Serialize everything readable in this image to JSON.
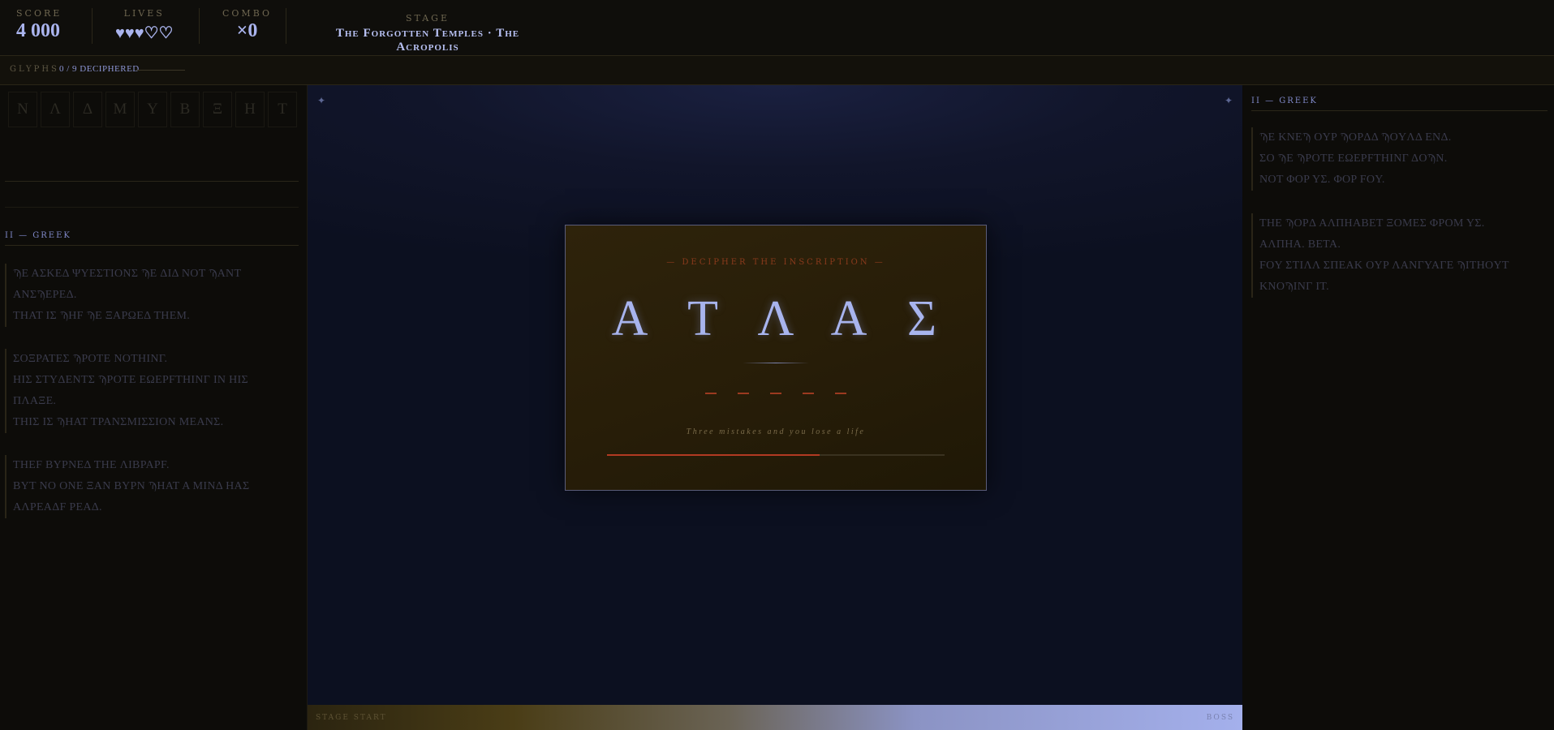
{
  "hud": {
    "score": {
      "label": "SCORE",
      "value": "4 000"
    },
    "lives": {
      "label": "LIVES",
      "value": "♥♥♥♡♡",
      "current": 3,
      "max": 5
    },
    "combo": {
      "label": "COMBO",
      "value": "×0"
    },
    "stage": {
      "label": "STAGE",
      "title": "The Forgotten Temples · The Acropolis"
    }
  },
  "glyphs": {
    "label": "GLYPHS",
    "count": "0 / 9 DECIPHERED",
    "deciphered": 0,
    "total": 9
  },
  "glyph_cells": [
    "N",
    "Λ",
    "Δ",
    "M",
    "Y",
    "B",
    "Ξ",
    "H",
    "T"
  ],
  "left_panel": {
    "heading": "II — GREEK",
    "verses": [
      [
        "ϠE AΣKEΔ ΨYEΣTIONΣ ϠE ΔIΔ NOT ϠANT ANΣϠEPEΔ.",
        "THAT IΣ ϠHF ϠE ΞAPΩEΔ THEM."
      ],
      [
        "ΣOΞPATEΣ ϠPOTE NOTHINΓ.",
        "HIΣ ΣTYΔENTΣ ϠPOTE EΩEPFTHINΓ IN HIΣ ΠΛAΞE.",
        "THIΣ IΣ ϠHAT TPANΣMIΣΣION MEANΣ."
      ],
      [
        "THEF BYPNEΔ THE ΛIBPAPF.",
        "BYT NO ONE ΞAN BYPN ϠHAT A MINΔ HAΣ AΛPEAΔF PEAΔ."
      ]
    ]
  },
  "right_panel": {
    "heading": "II — GREEK",
    "verses": [
      [
        "ϠE KNEϠ OYP ϠOPΔΔ ϠOYΛΔ ENΔ.",
        "ΣO ϠE ϠPOTE EΩEPFTHINΓ ΔOϠN.",
        "NOT ΦOP YΣ. ΦOP FOY."
      ],
      [
        "THE ϠOPΔ AΛΠHABET ΞOMEΣ ΦPOM YΣ.",
        "AΛΠHA. BETA.",
        "FOY ΣTIΛΛ ΣΠEAK OYP ΛANΓYAΓE ϠITHOYT KNOϠINΓ IT."
      ]
    ]
  },
  "puzzle": {
    "title": "— DECIPHER THE INSCRIPTION —",
    "letters": [
      "Α",
      "Τ",
      "Λ",
      "Α",
      "Σ"
    ],
    "hint": "Three mistakes and you lose a life",
    "timer_remaining": 0.63
  },
  "progress": {
    "start_label": "STAGE START",
    "end_label": "BOSS"
  },
  "colors": {
    "accent": "#aab4ee",
    "gold": "#2e230b",
    "danger": "#b23a22"
  }
}
